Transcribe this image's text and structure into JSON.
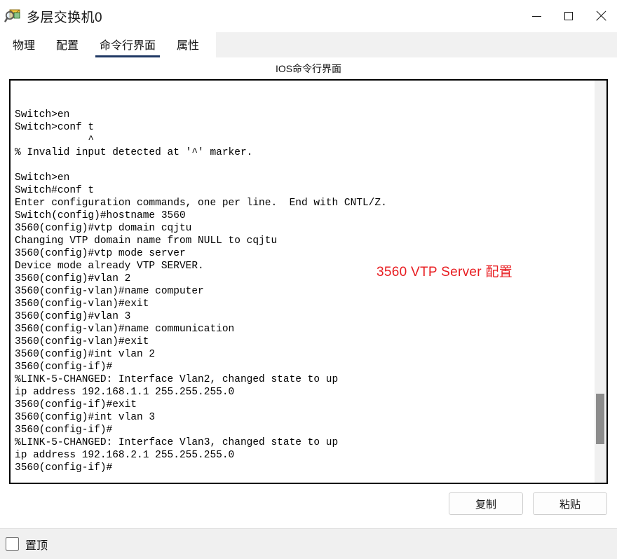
{
  "window": {
    "title": "多层交换机0",
    "icon": "magnifier-document-icon",
    "controls": {
      "minimize": "minimize-icon",
      "maximize": "maximize-icon",
      "close": "close-icon"
    }
  },
  "tabs": [
    {
      "label": "物理",
      "active": false
    },
    {
      "label": "配置",
      "active": false
    },
    {
      "label": "命令行界面",
      "active": true
    },
    {
      "label": "属性",
      "active": false
    }
  ],
  "panel": {
    "title": "IOS命令行界面"
  },
  "terminal": {
    "lines": [
      "",
      "",
      "Switch>en",
      "Switch>conf t",
      "            ^",
      "% Invalid input detected at '^' marker.",
      "",
      "Switch>en",
      "Switch#conf t",
      "Enter configuration commands, one per line.  End with CNTL/Z.",
      "Switch(config)#hostname 3560",
      "3560(config)#vtp domain cqjtu",
      "Changing VTP domain name from NULL to cqjtu",
      "3560(config)#vtp mode server",
      "Device mode already VTP SERVER.",
      "3560(config)#vlan 2",
      "3560(config-vlan)#name computer",
      "3560(config-vlan)#exit",
      "3560(config)#vlan 3",
      "3560(config-vlan)#name communication",
      "3560(config-vlan)#exit",
      "3560(config)#int vlan 2",
      "3560(config-if)#",
      "%LINK-5-CHANGED: Interface Vlan2, changed state to up",
      "ip address 192.168.1.1 255.255.255.0",
      "3560(config-if)#exit",
      "3560(config)#int vlan 3",
      "3560(config-if)#",
      "%LINK-5-CHANGED: Interface Vlan3, changed state to up",
      "ip address 192.168.2.1 255.255.255.0",
      "3560(config-if)#"
    ],
    "annotation": "3560 VTP Server 配置",
    "annotation_color": "#e81c20"
  },
  "actions": {
    "copy_label": "复制",
    "paste_label": "粘贴"
  },
  "footer": {
    "always_on_top_label": "置顶",
    "always_on_top_checked": false
  }
}
